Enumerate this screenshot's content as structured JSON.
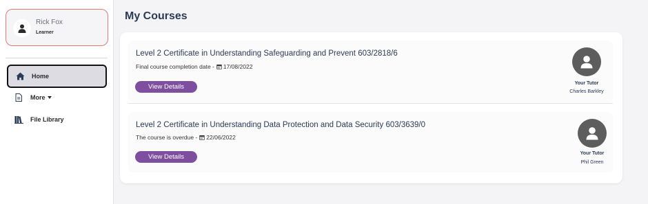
{
  "profile": {
    "name": "Rick Fox",
    "role": "Learner"
  },
  "nav": {
    "home_label": "Home",
    "more_label": "More",
    "files_label": "File Library"
  },
  "page": {
    "title": "My Courses"
  },
  "courses": [
    {
      "title": "Level 2 Certificate in Understanding Safeguarding and Prevent 603/2818/6",
      "status_text": "Final course completion date -",
      "date": "17/08/2022",
      "button_label": "View Details",
      "tutor_label": "Your Tutor",
      "tutor_name": "Charles Barkley"
    },
    {
      "title": "Level 2 Certificate in Understanding Data Protection and Data Security 603/3639/0",
      "status_text": "The course is overdue -",
      "date": "22/06/2022",
      "button_label": "View Details",
      "tutor_label": "Your Tutor",
      "tutor_name": "Phil Green"
    }
  ],
  "colors": {
    "accent": "#7d4f9e",
    "profile_border": "#e37a72",
    "heading": "#2b3a55",
    "avatar_bg": "#5d5d5d"
  }
}
